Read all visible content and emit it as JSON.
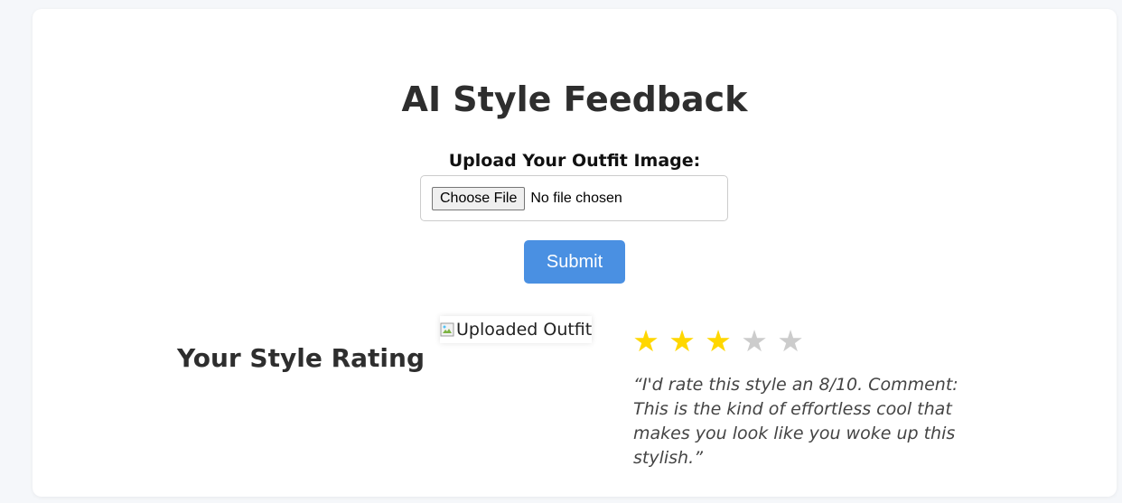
{
  "page": {
    "title": "AI Style Feedback"
  },
  "upload": {
    "label": "Upload Your Outfit Image:",
    "choose_button_label": "Choose File",
    "file_status": "No file chosen",
    "submit_label": "Submit"
  },
  "result": {
    "heading": "Your Style Rating",
    "image_alt": "Uploaded Outfit",
    "stars_filled": 3,
    "stars_total": 5,
    "star_glyph": "★",
    "comment": "“I'd rate this style an 8/10. Comment: This is the kind of effortless cool that makes you look like you woke up this stylish.”"
  },
  "colors": {
    "accent": "#4a90e2",
    "star_filled": "#ffd700",
    "star_empty": "#cccccc",
    "background": "#f5f7fa",
    "card": "#ffffff"
  },
  "icons": {
    "broken_image": "broken-image-icon",
    "star": "star-icon"
  }
}
